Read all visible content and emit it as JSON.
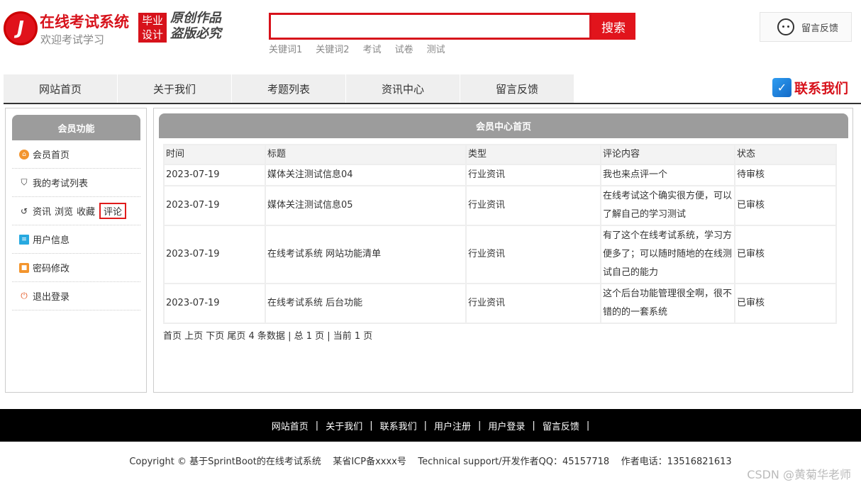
{
  "header": {
    "logo_letter": "J",
    "site_title": "在线考试系统",
    "site_subtitle": "欢迎考试学习",
    "grad_badge": [
      "毕业",
      "设计"
    ],
    "slogan": [
      "原创作品",
      "盗版必究"
    ],
    "search": {
      "placeholder": "",
      "button": "搜索"
    },
    "keywords": [
      "关键词1",
      "关键词2",
      "考试",
      "试卷",
      "测试"
    ],
    "feedback_button": "留言反馈"
  },
  "nav": {
    "items": [
      "网站首页",
      "关于我们",
      "考题列表",
      "资讯中心",
      "留言反馈"
    ],
    "contact": "联系我们"
  },
  "sidebar": {
    "title": "会员功能",
    "items": [
      {
        "label": "会员首页",
        "icon": "home-icon"
      },
      {
        "label": "我的考试列表",
        "icon": "shield-icon"
      },
      {
        "label": "资讯",
        "icon": "history-icon"
      },
      {
        "label": "用户信息",
        "icon": "clipboard-icon"
      },
      {
        "label": "密码修改",
        "icon": "lock-icon"
      },
      {
        "label": "退出登录",
        "icon": "power-icon"
      }
    ],
    "sub_links": [
      "浏览",
      "收藏",
      "评论"
    ]
  },
  "main": {
    "title": "会员中心首页",
    "columns": [
      "时间",
      "标题",
      "类型",
      "评论内容",
      "状态"
    ],
    "rows": [
      [
        "2023-07-19",
        "媒体关注测试信息04",
        "行业资讯",
        "我也来点评一个",
        "待审核"
      ],
      [
        "2023-07-19",
        "媒体关注测试信息05",
        "行业资讯",
        "在线考试这个确实很方便，可以了解自己的学习测试",
        "已审核"
      ],
      [
        "2023-07-19",
        "在线考试系统 网站功能清单",
        "行业资讯",
        "有了这个在线考试系统，学习方便多了；可以随时随地的在线测试自己的能力",
        "已审核"
      ],
      [
        "2023-07-19",
        "在线考试系统 后台功能",
        "行业资讯",
        "这个后台功能管理很全啊，很不错的的一套系统",
        "已审核"
      ]
    ],
    "pager": "首页 上页 下页 尾页 4 条数据 | 总 1 页 | 当前 1 页"
  },
  "footer": {
    "links": [
      "网站首页",
      "关于我们",
      "联系我们",
      "用户注册",
      "用户登录",
      "留言反馈"
    ],
    "separator": "|",
    "copyright": "Copyright © 基于SprintBoot的在线考试系统    某省ICP备xxxx号    Technical support/开发作者QQ：45157718    作者电话：13516821613",
    "watermark": "CSDN @黄菊华老师"
  },
  "colors": {
    "brand_red": "#d7121b",
    "panel_gray": "#9c9c9c",
    "footer_bg": "#000000"
  }
}
